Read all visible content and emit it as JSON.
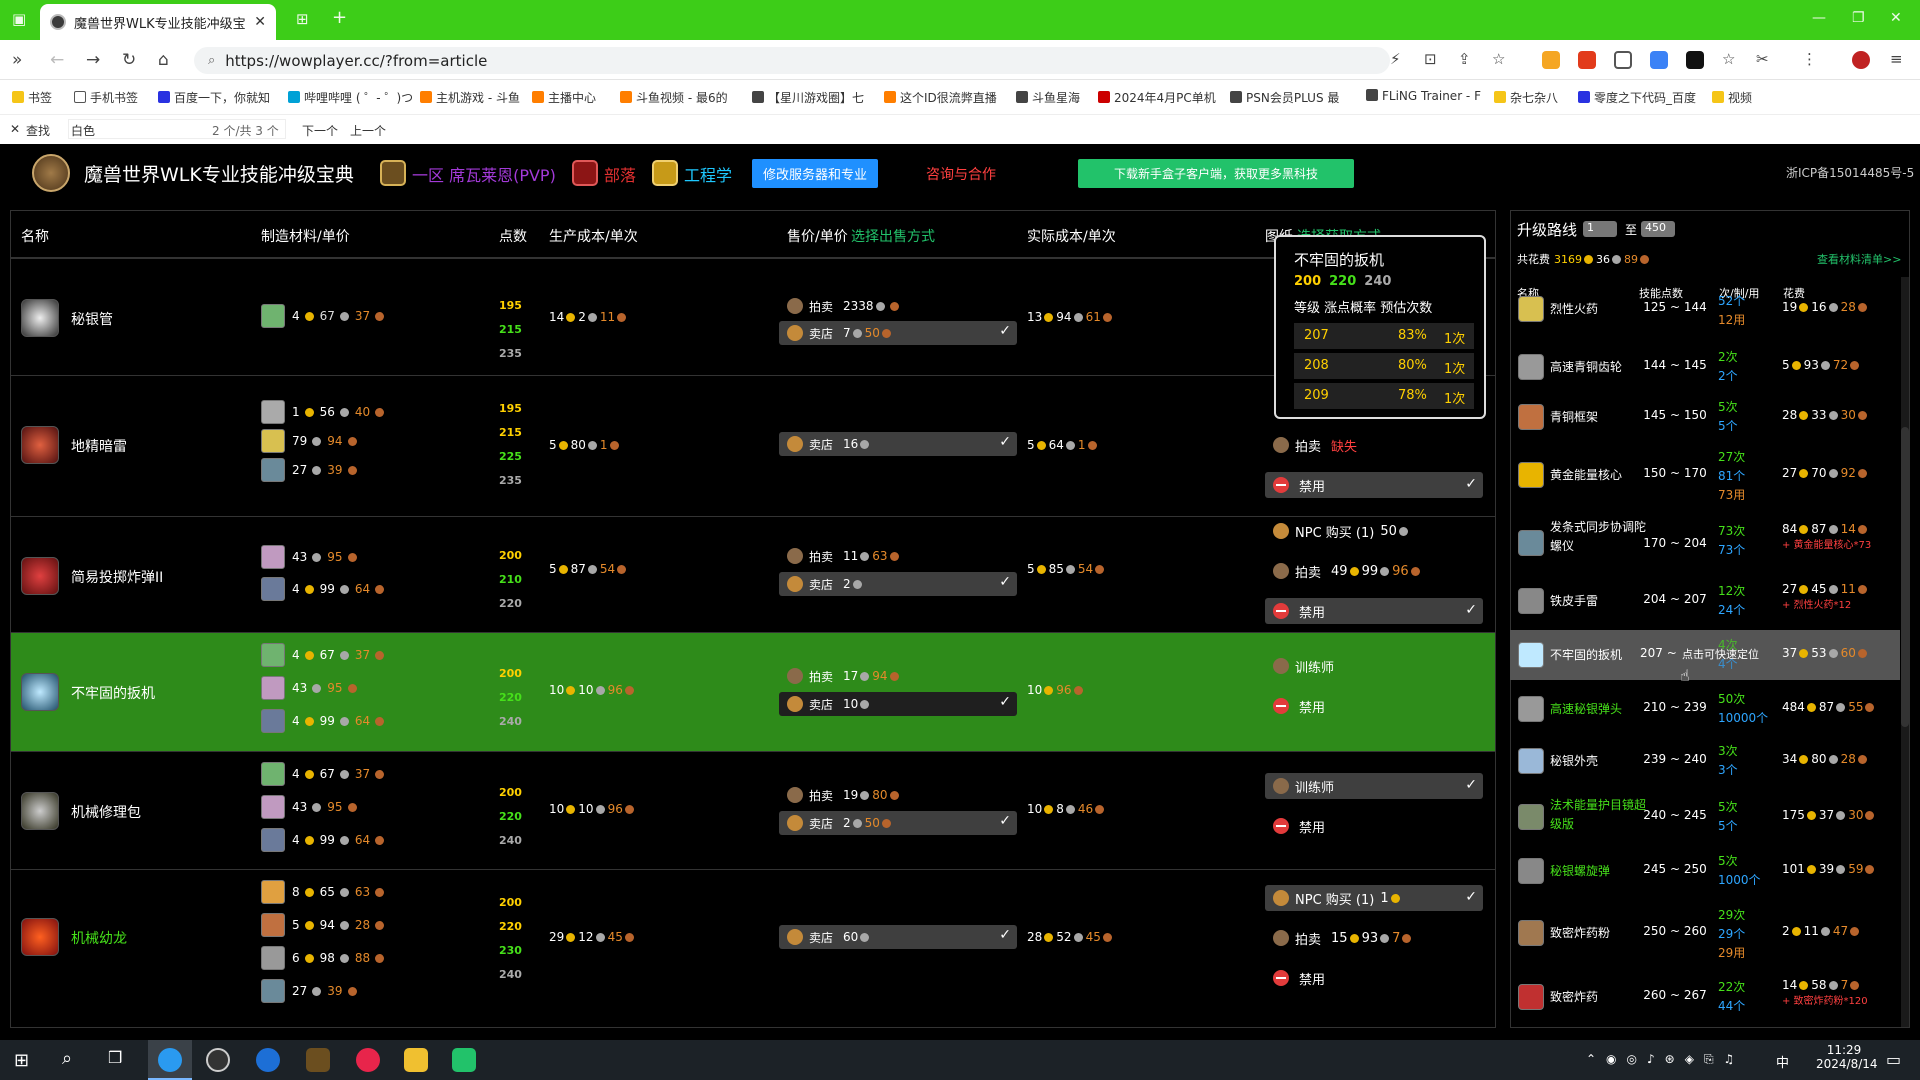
{
  "browser": {
    "tab_title": "魔兽世界WLK专业技能冲级宝典",
    "url": "https://wowplayer.cc/?from=article",
    "bookmarks": [
      "书签",
      "手机书签",
      "百度一下，你就知",
      "哔哩哔哩 ( ゜- ゜)つ",
      "主机游戏 - 斗鱼",
      "主播中心",
      "斗鱼视频 - 最6的",
      "【星川游戏圈】七",
      "这个ID很流弊直播",
      "斗鱼星海",
      "2024年4月PC单机",
      "PSN会员PLUS 最",
      "FLiNG Trainer - F",
      "杂七杂八",
      "零度之下代码_百度",
      "视频"
    ],
    "find": {
      "label": "查找",
      "query": "白色",
      "count": "2 个/共 3 个",
      "next": "下一个",
      "prev": "上一个"
    }
  },
  "header": {
    "site_title": "魔兽世界WLK专业技能冲级宝典",
    "server": "一区 席瓦莱恩(PVP)",
    "faction": "部落",
    "profession": "工程学",
    "btn_modify": "修改服务器和专业",
    "consult": "咨询与合作",
    "download": "下载新手盒子客户端，获取更多黑科技",
    "icp": "浙ICP备15014485号-5"
  },
  "colors": {
    "accent_green": "#3dcd18",
    "row_highlight": "#2e8b1a",
    "blue_button": "#1f90ff",
    "link_green": "#22c26a",
    "gold": "#ffd000",
    "orange_point": "#ffd000",
    "green_point": "#46e01a",
    "copper": "#e58a2b",
    "missing_red": "#ff4040",
    "count_blue": "#2ea6ff"
  },
  "table": {
    "headers": {
      "name": "名称",
      "materials": "制造材料/单价",
      "points": "点数",
      "prod_cost": "生产成本/单次",
      "sell": "售价/单价",
      "sell_opt": "选择出售方式",
      "real_cost": "实际成本/单次",
      "recipe": "图纸",
      "recipe_opt": "选择获取方式"
    },
    "labels": {
      "auction": "拍卖",
      "vendor": "卖店",
      "trainer": "训练师",
      "ban": "禁用",
      "npc_buy": "NPC 购买 (1)",
      "missing": "缺失"
    },
    "rows": [
      {
        "name": "秘银管",
        "points": [
          "195",
          "215",
          "235"
        ],
        "mats": [
          {
            "g": "4",
            "s": "67",
            "c": "37",
            "badge": ""
          }
        ],
        "prod": {
          "g": "14",
          "s": "2",
          "c": "11"
        },
        "auction": {
          "g": "23",
          "s": "38",
          "c": ""
        },
        "vendor": {
          "g": "7",
          "s": "50",
          "c": ""
        },
        "real": {
          "g": "13",
          "s": "94",
          "c": "61"
        }
      },
      {
        "name": "地精暗雷",
        "points": [
          "195",
          "215",
          "225",
          "235"
        ],
        "mats": [
          {
            "g": "1",
            "s": "56",
            "c": "40",
            "badge": "2"
          },
          {
            "g": "",
            "s": "79",
            "c": "94",
            "badge": ""
          },
          {
            "g": "",
            "s": "27",
            "c": "39",
            "badge": ""
          }
        ],
        "prod": {
          "g": "5",
          "s": "80",
          "c": "1"
        },
        "vendor": {
          "g": "",
          "s": "16",
          "c": ""
        },
        "real": {
          "g": "5",
          "s": "64",
          "c": "1"
        },
        "recipe_auction_status": "缺失"
      },
      {
        "name": "简易投掷炸弹II",
        "points": [
          "200",
          "210",
          "220"
        ],
        "mats": [
          {
            "g": "",
            "s": "43",
            "c": "95",
            "badge": "2"
          },
          {
            "g": "4",
            "s": "99",
            "c": "64",
            "badge": ""
          }
        ],
        "prod": {
          "g": "5",
          "s": "87",
          "c": "54"
        },
        "auction": {
          "g": "",
          "s": "11",
          "c": "63"
        },
        "vendor": {
          "g": "",
          "s": "2",
          "c": ""
        },
        "real": {
          "g": "5",
          "s": "85",
          "c": "54"
        },
        "npc": {
          "g": "",
          "s": "50",
          "c": ""
        },
        "recipe_auction": {
          "g": "49",
          "s": "99",
          "c": "96"
        }
      },
      {
        "name": "不牢固的扳机",
        "points": [
          "200",
          "220",
          "240"
        ],
        "mats": [
          {
            "g": "4",
            "s": "67",
            "c": "37",
            "badge": ""
          },
          {
            "g": "",
            "s": "43",
            "c": "95",
            "badge": ""
          },
          {
            "g": "4",
            "s": "99",
            "c": "64",
            "badge": ""
          }
        ],
        "prod": {
          "g": "10",
          "s": "10",
          "c": "96"
        },
        "auction": {
          "g": "",
          "s": "17",
          "c": "94"
        },
        "vendor": {
          "g": "",
          "s": "10",
          "c": ""
        },
        "real": {
          "g": "10",
          "s": "",
          "c": "96"
        }
      },
      {
        "name": "机械修理包",
        "points": [
          "200",
          "220",
          "240"
        ],
        "mats": [
          {
            "g": "4",
            "s": "67",
            "c": "37",
            "badge": ""
          },
          {
            "g": "",
            "s": "43",
            "c": "95",
            "badge": ""
          },
          {
            "g": "4",
            "s": "99",
            "c": "64",
            "badge": ""
          }
        ],
        "prod": {
          "g": "10",
          "s": "10",
          "c": "96"
        },
        "auction": {
          "g": "",
          "s": "19",
          "c": "80"
        },
        "vendor": {
          "g": "",
          "s": "2",
          "c": "50"
        },
        "real": {
          "g": "10",
          "s": "8",
          "c": "46"
        }
      },
      {
        "name": "机械幼龙",
        "points": [
          "200",
          "220",
          "230",
          "240"
        ],
        "mats": [
          {
            "g": "8",
            "s": "65",
            "c": "63",
            "badge": ""
          },
          {
            "g": "5",
            "s": "94",
            "c": "28",
            "badge": ""
          },
          {
            "g": "6",
            "s": "98",
            "c": "88",
            "badge": "2"
          },
          {
            "g": "",
            "s": "27",
            "c": "39",
            "badge": ""
          }
        ],
        "prod": {
          "g": "29",
          "s": "12",
          "c": "45"
        },
        "vendor": {
          "g": "",
          "s": "60",
          "c": ""
        },
        "real": {
          "g": "28",
          "s": "52",
          "c": "45"
        },
        "npc": {
          "g": "1",
          "s": "",
          "c": ""
        },
        "recipe_auction": {
          "g": "15",
          "s": "93",
          "c": "7"
        }
      }
    ]
  },
  "tooltip": {
    "title": "不牢固的扳机",
    "p1": "200",
    "p2": "220",
    "p3": "240",
    "header": "等级 涨点概率 预估次数",
    "rows": [
      [
        "207",
        "83%",
        "1次"
      ],
      [
        "208",
        "80%",
        "1次"
      ],
      [
        "209",
        "78%",
        "1次"
      ]
    ]
  },
  "route": {
    "title": "升级路线",
    "from": "1",
    "to_word": "至",
    "to": "450",
    "total_label": "共花费",
    "total": {
      "g": "3169",
      "s": "36",
      "c": "89"
    },
    "view_list": "查看材料清单>>",
    "headers": [
      "名称",
      "技能点数",
      "次/制/用",
      "花费"
    ],
    "hover_hint": "点击可快速定位",
    "rows": [
      {
        "name": "烈性火药",
        "range": "125 ~ 144",
        "cnt": [
          "52个",
          "12用"
        ],
        "fee": {
          "g": "19",
          "s": "16",
          "c": "28"
        },
        "note": ""
      },
      {
        "name": "高速青铜齿轮",
        "range": "144 ~ 145",
        "cnt": [
          "2次",
          "2个"
        ],
        "fee": {
          "g": "5",
          "s": "93",
          "c": "72"
        },
        "note": ""
      },
      {
        "name": "青铜框架",
        "range": "145 ~ 150",
        "cnt": [
          "5次",
          "5个"
        ],
        "fee": {
          "g": "28",
          "s": "33",
          "c": "30"
        },
        "note": ""
      },
      {
        "name": "黄金能量核心",
        "range": "150 ~ 170",
        "cnt": [
          "27次",
          "81个",
          "73用"
        ],
        "fee": {
          "g": "27",
          "s": "70",
          "c": "92"
        },
        "note": ""
      },
      {
        "name": "发条式同步协调陀螺仪",
        "range": "170 ~ 204",
        "cnt": [
          "73次",
          "73个"
        ],
        "fee": {
          "g": "84",
          "s": "87",
          "c": "14"
        },
        "note": "+ 黄金能量核心*73"
      },
      {
        "name": "铁皮手雷",
        "range": "204 ~ 207",
        "cnt": [
          "12次",
          "24个"
        ],
        "fee": {
          "g": "27",
          "s": "45",
          "c": "11"
        },
        "note": "+ 烈性火药*12"
      },
      {
        "name": "不牢固的扳机",
        "range": "207 ~",
        "cnt": [
          "4次",
          "4个"
        ],
        "fee": {
          "g": "37",
          "s": "53",
          "c": "60"
        },
        "note": ""
      },
      {
        "name": "高速秘银弹头",
        "range": "210 ~ 239",
        "cnt": [
          "50次",
          "10000个"
        ],
        "fee": {
          "g": "484",
          "s": "87",
          "c": "55"
        },
        "note": ""
      },
      {
        "name": "秘银外壳",
        "range": "239 ~ 240",
        "cnt": [
          "3次",
          "3个"
        ],
        "fee": {
          "g": "34",
          "s": "80",
          "c": "28"
        },
        "note": ""
      },
      {
        "name": "法术能量护目镜超级版",
        "range": "240 ~ 245",
        "cnt": [
          "5次",
          "5个"
        ],
        "fee": {
          "g": "175",
          "s": "37",
          "c": "30"
        },
        "note": ""
      },
      {
        "name": "秘银螺旋弹",
        "range": "245 ~ 250",
        "cnt": [
          "5次",
          "1000个"
        ],
        "fee": {
          "g": "101",
          "s": "39",
          "c": "59"
        },
        "note": ""
      },
      {
        "name": "致密炸药粉",
        "range": "250 ~ 260",
        "cnt": [
          "29次",
          "29个",
          "29用"
        ],
        "fee": {
          "g": "2",
          "s": "11",
          "c": "47"
        },
        "note": ""
      },
      {
        "name": "致密炸药",
        "range": "260 ~ 267",
        "cnt": [
          "22次",
          "44个"
        ],
        "fee": {
          "g": "14",
          "s": "58",
          "c": "7"
        },
        "note": "+ 致密炸药粉*120"
      }
    ]
  },
  "taskbar": {
    "time": "11:29",
    "date": "2024/8/14",
    "ime": "中"
  }
}
